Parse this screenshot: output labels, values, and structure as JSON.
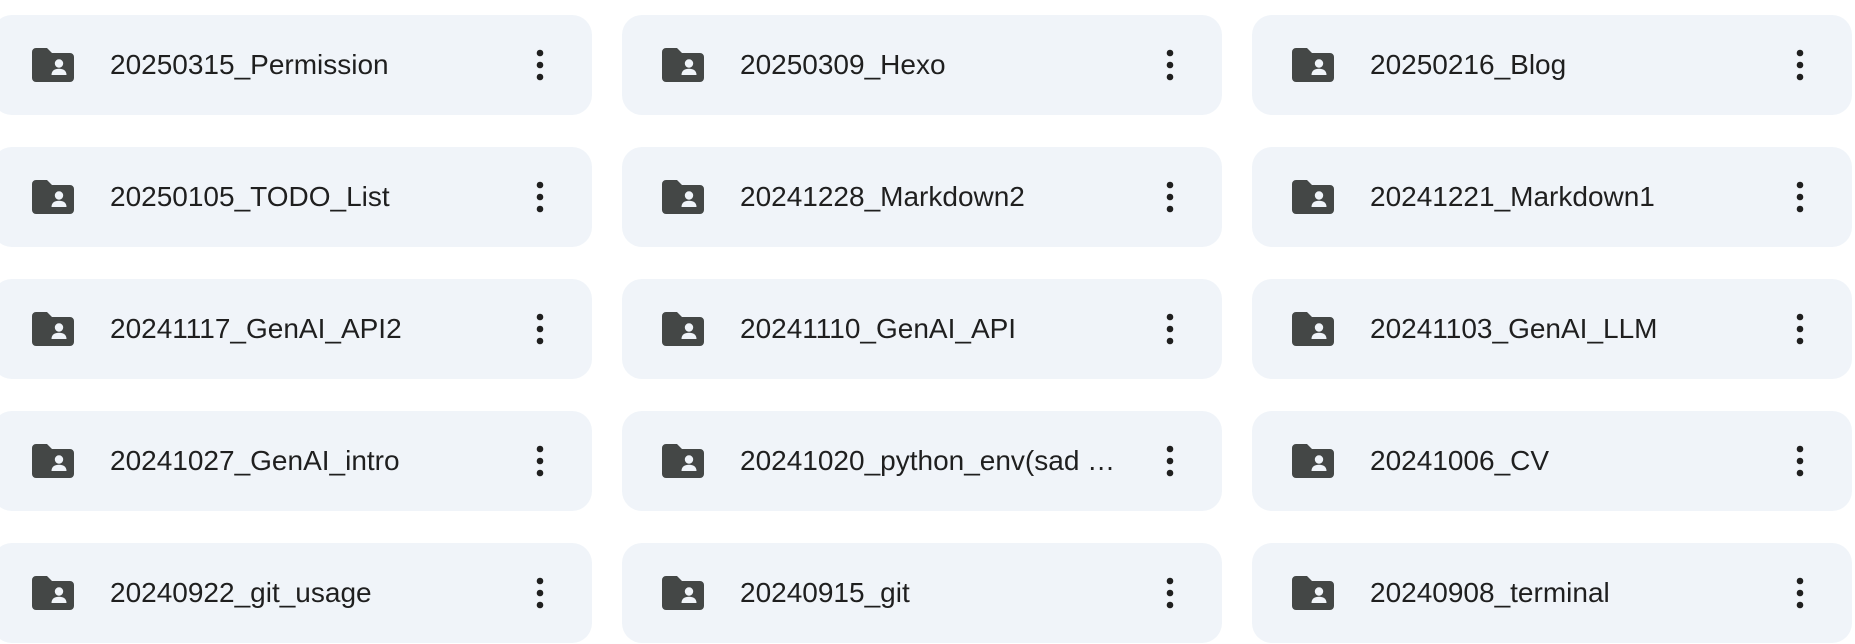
{
  "folders": [
    {
      "name": "20250315_Permission"
    },
    {
      "name": "20250309_Hexo"
    },
    {
      "name": "20250216_Blog"
    },
    {
      "name": "20250105_TODO_List"
    },
    {
      "name": "20241228_Markdown2"
    },
    {
      "name": "20241221_Markdown1"
    },
    {
      "name": "20241117_GenAI_API2"
    },
    {
      "name": "20241110_GenAI_API"
    },
    {
      "name": "20241103_GenAI_LLM"
    },
    {
      "name": "20241027_GenAI_intro"
    },
    {
      "name": "20241020_python_env(sad …"
    },
    {
      "name": "20241006_CV"
    },
    {
      "name": "20240922_git_usage"
    },
    {
      "name": "20240915_git"
    },
    {
      "name": "20240908_terminal"
    }
  ],
  "icons": {
    "folder": "shared-folder-icon",
    "menu": "more-vert-icon"
  },
  "colors": {
    "card_background": "#f0f4f9",
    "icon": "#444746",
    "text": "#1f1f1f"
  }
}
